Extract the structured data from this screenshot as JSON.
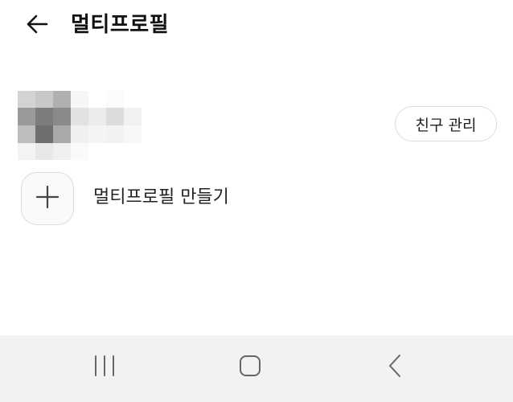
{
  "header": {
    "back_icon": "arrow-left-icon",
    "title": "멀티프로필"
  },
  "profile": {
    "avatar_note": "pixelated-avatar",
    "friend_manage_label": "친구 관리"
  },
  "add_profile": {
    "icon": "plus-icon",
    "label": "멀티프로필 만들기"
  },
  "navbar": {
    "recent_icon": "recent-apps-icon",
    "home_icon": "home-icon",
    "back_icon": "nav-back-icon"
  },
  "colors": {
    "background": "#ffffff",
    "navbar": "#f2f2f2",
    "border": "#dddddd",
    "text": "#111111"
  }
}
